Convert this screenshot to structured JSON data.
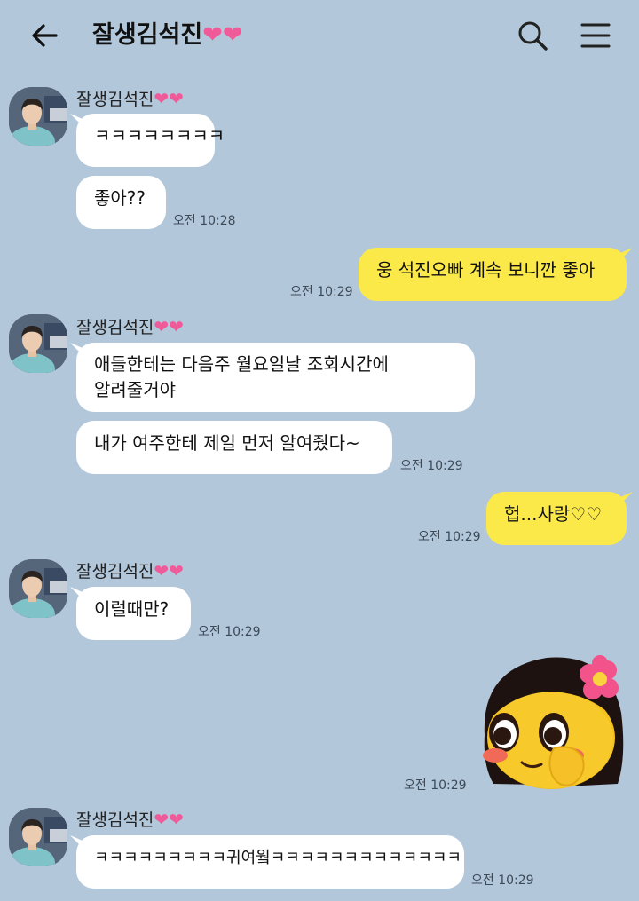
{
  "header": {
    "title": "잘생김석진",
    "title_hearts": "❤❤"
  },
  "sender_name": "잘생김석진",
  "sender_hearts": "❤❤",
  "messages": {
    "m1": "ㅋㅋㅋㅋㅋㅋㅋㅋ",
    "m2": "좋아??",
    "m2_time": "오전 10:28",
    "m3": "웅 석진오빠 계속 보니깐 좋아",
    "m3_time": "오전 10:29",
    "m4_line1": "애들한테는 다음주 월요일날 조회시간에",
    "m4_line2": "알려줄거야",
    "m5": "내가 여주한테 제일 먼저 알여줬다~",
    "m5_time": "오전 10:29",
    "m6": "헙...사랑♡♡",
    "m6_time": "오전 10:29",
    "m7": "이럴때만?",
    "m7_time": "오전 10:29",
    "m8_time": "오전 10:29",
    "m9": "ㅋㅋㅋㅋㅋㅋㅋㅋㅋ귀여웤ㅋㅋㅋㅋㅋㅋㅋㅋㅋㅋㅋㅋㅋ",
    "m9_time": "오전 10:29"
  },
  "colors": {
    "background": "#b2c7da",
    "bubble_in": "#ffffff",
    "bubble_out": "#fbe94a",
    "heart": "#ef5a98"
  },
  "icons": {
    "back": "arrow-left-icon",
    "search": "search-icon",
    "menu": "hamburger-menu-icon",
    "emoticon": "blushing-girl-emoticon"
  }
}
